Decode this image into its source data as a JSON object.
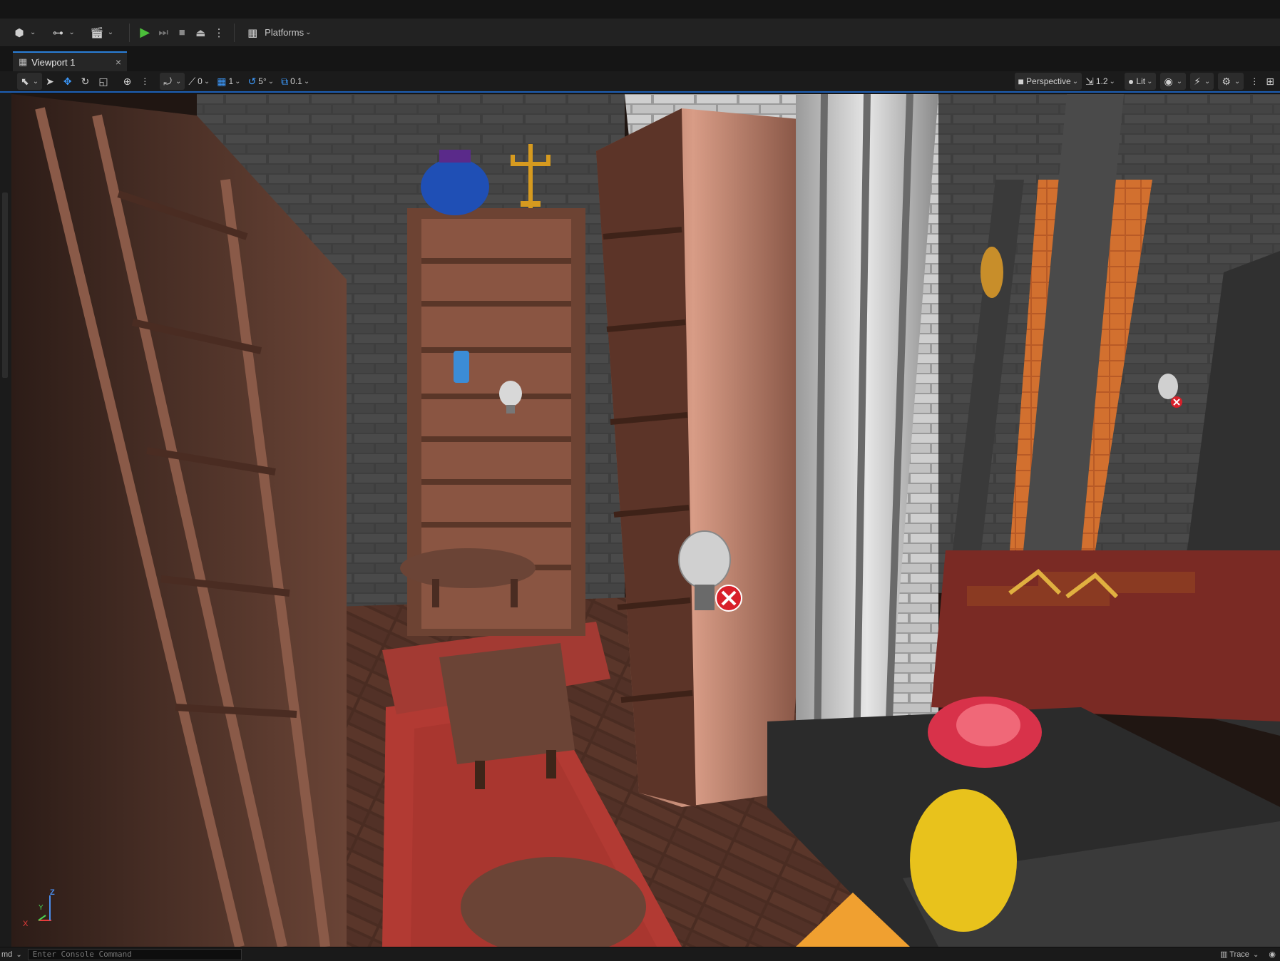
{
  "main_toolbar": {
    "platforms_label": "Platforms"
  },
  "tabs": [
    {
      "label": "Viewport 1"
    }
  ],
  "viewport_toolbar": {
    "rotation_snap": "0",
    "grid_snap": "1",
    "angle_snap": "5°",
    "scale_snap": "0.1",
    "view_mode": "Perspective",
    "camera_speed": "1.2",
    "lighting_mode": "Lit"
  },
  "gizmo": {
    "z": "Z",
    "y": "Y",
    "x": "X"
  },
  "status_bar": {
    "cmd_label": "md",
    "console_placeholder": "Enter Console Command",
    "trace_label": "Trace"
  },
  "colors": {
    "accent": "#2a7fd8",
    "play": "#4bbf3a",
    "panel": "#222222"
  }
}
